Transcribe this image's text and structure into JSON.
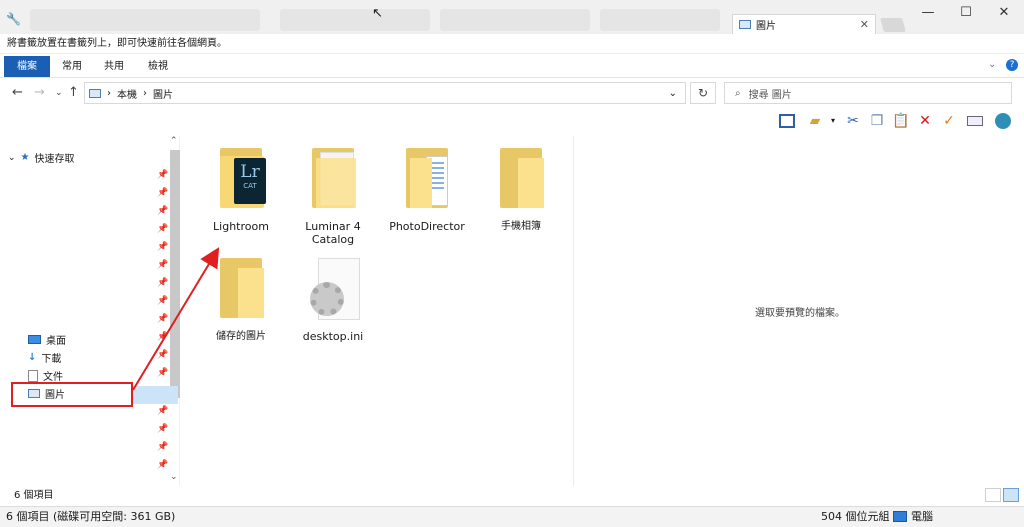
{
  "window": {
    "tab_title": "圖片",
    "minimize": "—",
    "maximize": "☐",
    "close": "✕"
  },
  "bookmarks": {
    "hint": "將書籤放置在書籤列上，即可快速前往各個網頁。"
  },
  "ribbon": {
    "tabs": [
      "檔案",
      "常用",
      "共用",
      "檢視"
    ]
  },
  "address": {
    "segments": [
      "本機",
      "圖片"
    ],
    "search_placeholder": "搜尋 圖片"
  },
  "navpane": {
    "quick_access": "快速存取",
    "items": [
      {
        "label": "桌面",
        "icon": "desktop-icon"
      },
      {
        "label": "下載",
        "icon": "download-icon"
      },
      {
        "label": "文件",
        "icon": "documents-icon"
      },
      {
        "label": "圖片",
        "icon": "pictures-icon"
      }
    ]
  },
  "files": [
    {
      "name": "Lightroom",
      "icon": "lightroom-folder-icon"
    },
    {
      "name": "Luminar 4 Catalog",
      "icon": "folder-doc-icon"
    },
    {
      "name": "PhotoDirector",
      "icon": "folder-doc-icon"
    },
    {
      "name": "手機相簿",
      "icon": "folder-icon"
    },
    {
      "name": "儲存的圖片",
      "icon": "folder-icon"
    },
    {
      "name": "desktop.ini",
      "icon": "settings-file-icon"
    }
  ],
  "lightroom_badge": {
    "main": "Lr",
    "sub": "CAT"
  },
  "preview": {
    "empty_text": "選取要預覽的檔案。"
  },
  "status": {
    "item_count": "6 個項目",
    "free_space": "6 個項目 (磁碟可用空間: 361 GB)",
    "size": "504 個位元組",
    "location": "電腦"
  },
  "colors": {
    "accent": "#1a5fb4",
    "highlight_box": "#e02020",
    "folder": "#f8d775"
  }
}
